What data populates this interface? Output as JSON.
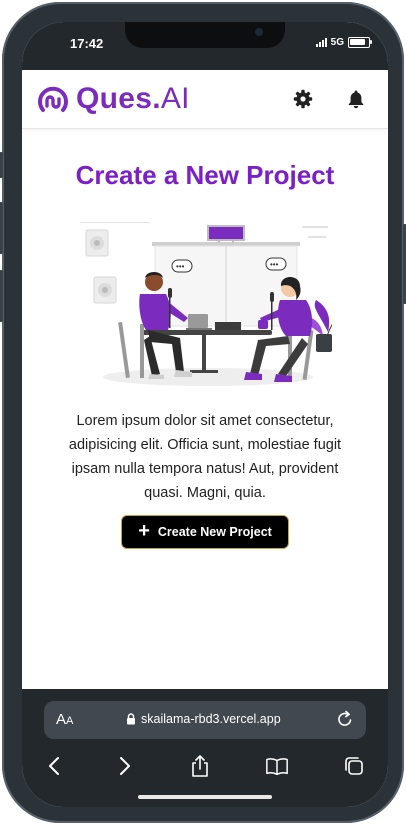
{
  "status_bar": {
    "time": "17:42",
    "network": "5G"
  },
  "app": {
    "logo": {
      "brand": "Ques.",
      "suffix": "AI"
    },
    "heading": "Create a New Project",
    "description": "Lorem ipsum dolor sit amet consectetur, adipisicing elit. Officia sunt, molestiae fugit ipsam nulla tempora natus! Aut, provident quasi. Magni, quia.",
    "create_button": {
      "icon": "plus-icon",
      "label": "Create New Project"
    },
    "settings_icon": "gear-icon",
    "notifications_icon": "bell-icon"
  },
  "browser": {
    "text_size_label": {
      "big": "A",
      "small": "A"
    },
    "url": "skailama-rbd3.vercel.app",
    "nav": [
      "back-icon",
      "forward-icon",
      "share-icon",
      "bookmarks-icon",
      "tabs-icon"
    ]
  },
  "colors": {
    "brand": "#7b2cbf",
    "heading": "#7b1fc7",
    "button": "#000000",
    "chrome": "#23282d"
  }
}
